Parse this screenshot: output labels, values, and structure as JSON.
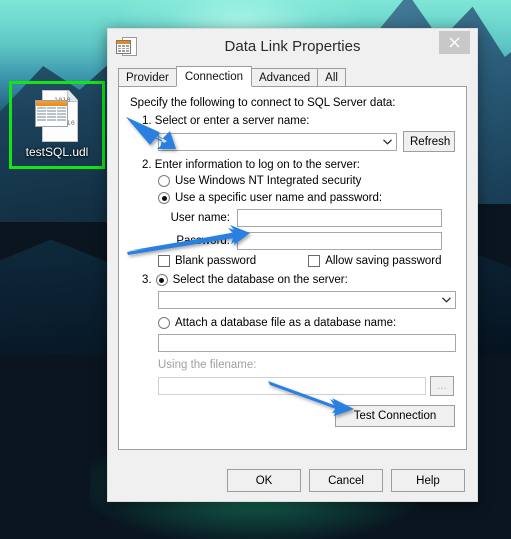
{
  "desktop": {
    "icon": {
      "name": "testSQL.udl",
      "icon_name": "udl-file-icon",
      "binary_text_lines": [
        "1010",
        "01",
        "00",
        "01110"
      ],
      "highlight_color": "#12e512"
    },
    "wallpaper_colors": {
      "sky": "#5ec6c4",
      "mountain": "#1d4560",
      "lake": "#13a06f"
    }
  },
  "dialog": {
    "title": "Data Link Properties",
    "title_icon": "data-link-icon",
    "close_label": "×",
    "tabs": [
      {
        "label": "Provider",
        "active": false
      },
      {
        "label": "Connection",
        "active": true
      },
      {
        "label": "Advanced",
        "active": false
      },
      {
        "label": "All",
        "active": false
      }
    ],
    "connection": {
      "lead_text": "Specify the following to connect to SQL Server data:",
      "step1": {
        "label": "1. Select or enter a server name:",
        "server_value": "",
        "server_placeholder": "",
        "refresh_label": "Refresh"
      },
      "step2": {
        "label": "2. Enter information to log on to the server:",
        "radio_integrated": {
          "label": "Use Windows NT Integrated security",
          "checked": false
        },
        "radio_specific": {
          "label": "Use a specific user name and password:",
          "checked": true
        },
        "username_label": "User name:",
        "username_value": "",
        "password_label": "Password:",
        "password_value": "",
        "blank_password": {
          "label": "Blank password",
          "checked": false
        },
        "allow_saving": {
          "label": "Allow saving password",
          "checked": false
        }
      },
      "step3": {
        "number": "3.",
        "radio_select_db": {
          "label": "Select the database on the server:",
          "checked": true
        },
        "database_value": "",
        "radio_attach": {
          "label": "Attach a database file as a database name:",
          "checked": false
        },
        "attach_value": "",
        "using_filename_label": "Using the filename:",
        "filename_value": "",
        "browse_label": "...",
        "test_connection_label": "Test Connection"
      }
    },
    "footer": {
      "ok_label": "OK",
      "cancel_label": "Cancel",
      "help_label": "Help"
    }
  },
  "annotations": {
    "arrow_color": "#1f7fe0",
    "arrows": [
      {
        "name": "arrow-to-server-name",
        "target": "server name combo box"
      },
      {
        "name": "arrow-to-user-name",
        "target": "user name field"
      },
      {
        "name": "arrow-to-test-connection",
        "target": "Test Connection button"
      }
    ]
  }
}
